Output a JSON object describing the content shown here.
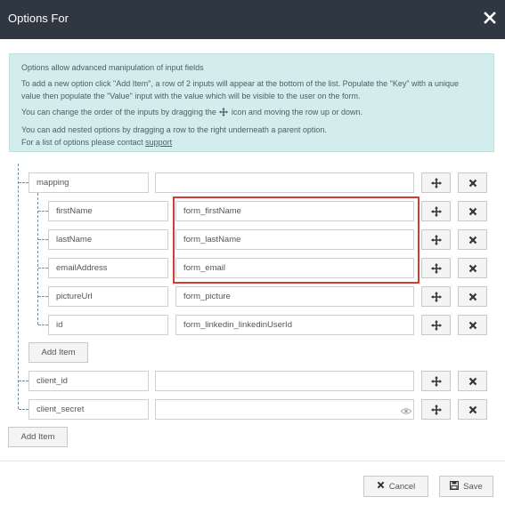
{
  "modal": {
    "title": "Options For"
  },
  "info": {
    "line1": "Options allow advanced manipulation of input fields",
    "line2": "To add a new option click \"Add Item\", a row of 2 inputs will appear at the bottom of the list. Populate the \"Key\" with a unique",
    "line3": "value then populate the \"Value\" input with the value which will be visible to the user on the form.",
    "line4a": "You can change the order of the inputs by dragging the",
    "line4b": "icon and moving the row up or down.",
    "line5": "You can add nested options by dragging a row to the right  underneath a parent option.",
    "line6a": "For a list of options please contact",
    "line6_link": "support"
  },
  "options": {
    "mapping": {
      "key": "mapping",
      "value": "",
      "children": [
        {
          "key": "firstName",
          "value": "form_firstName"
        },
        {
          "key": "lastName",
          "value": "form_lastName"
        },
        {
          "key": "emailAddress",
          "value": "form_email"
        },
        {
          "key": "pictureUrl",
          "value": "form_picture"
        },
        {
          "key": "id",
          "value": "form_linkedin_linkedinUserId"
        }
      ],
      "add_label": "Add Item"
    },
    "client_id": {
      "key": "client_id",
      "value": ""
    },
    "client_secret": {
      "key": "client_secret",
      "value": ""
    },
    "add_label": "Add Item"
  },
  "footer": {
    "cancel_label": "Cancel",
    "save_label": "Save"
  },
  "icons": {
    "close": "close-icon",
    "move": "move-icon",
    "remove": "remove-icon",
    "eye": "eye-icon",
    "save": "floppy-icon"
  },
  "colors": {
    "header": "#2e3742",
    "info_bg": "#d3ecec",
    "highlight": "#d23c34",
    "tree_line": "#6b8ea8"
  }
}
